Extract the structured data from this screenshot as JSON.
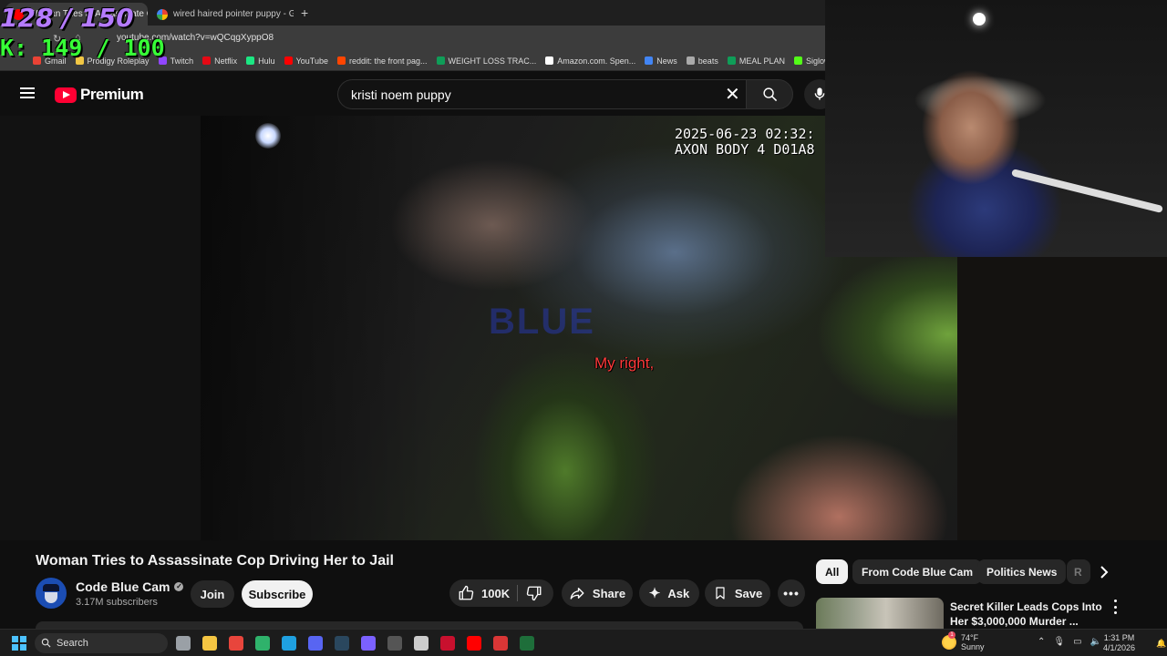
{
  "browser": {
    "tabs": [
      {
        "title": "Woman Tries to Assassinate Cop...",
        "active": true
      },
      {
        "title": "wired haired pointer puppy - G",
        "active": false
      }
    ],
    "new_tab_label": "+",
    "url": "youtube.com/watch?v=wQCqgXyppO8",
    "bookmarks": [
      {
        "label": "Gmail",
        "color": "#ea4335"
      },
      {
        "label": "Prodigy Roleplay",
        "color": "#f2c744"
      },
      {
        "label": "Twitch",
        "color": "#9146ff"
      },
      {
        "label": "Netflix",
        "color": "#e50914"
      },
      {
        "label": "Hulu",
        "color": "#1ce783"
      },
      {
        "label": "YouTube",
        "color": "#ff0000"
      },
      {
        "label": "reddit: the front pag...",
        "color": "#ff4500"
      },
      {
        "label": "WEIGHT LOSS TRAC...",
        "color": "#0f9d58"
      },
      {
        "label": "Amazon.com. Spen...",
        "color": "#ffffff"
      },
      {
        "label": "News",
        "color": "#4285f4"
      },
      {
        "label": "beats",
        "color": "#aaaaaa"
      },
      {
        "label": "MEAL PLAN",
        "color": "#0f9d58"
      },
      {
        "label": "Siglow Stream -",
        "color": "#53fc18"
      }
    ]
  },
  "overlay": {
    "counter_top": "128 / 150",
    "counter_kills": "K: 149 / 100"
  },
  "youtube": {
    "brand": "Premium",
    "search_query": "kristi noem puppy",
    "video": {
      "timestamp": "2025-06-23 02:32:\nAXON BODY 4 D01A8",
      "subtitle": "My right,",
      "watermark": "BLUE"
    },
    "title": "Woman Tries to Assassinate Cop Driving Her to Jail",
    "channel": {
      "name": "Code Blue Cam",
      "subscribers": "3.17M subscribers",
      "verified_mark": "✓"
    },
    "actions": {
      "join": "Join",
      "subscribe": "Subscribe",
      "likes": "100K",
      "share": "Share",
      "ask": "Ask",
      "save": "Save"
    },
    "chips": [
      "All",
      "From Code Blue Cam",
      "Politics News",
      "R"
    ],
    "recommended": {
      "title": "Secret Killer Leads Cops Into Her $3,000,000 Murder ..."
    }
  },
  "taskbar": {
    "search_label": "Search",
    "weather_temp": "74°F",
    "weather_cond": "Sunny",
    "notification_count": "1",
    "time": "1:31 PM",
    "date": "4/1/2026",
    "apps": [
      {
        "name": "task-view",
        "color": "#9aa0a6"
      },
      {
        "name": "file-explorer",
        "color": "#f4c542"
      },
      {
        "name": "chrome",
        "color": "#e8453c"
      },
      {
        "name": "app-green",
        "color": "#2fb26b"
      },
      {
        "name": "edge",
        "color": "#1fa0e0"
      },
      {
        "name": "discord",
        "color": "#5865f2"
      },
      {
        "name": "steam",
        "color": "#2a475e"
      },
      {
        "name": "app-multicolor",
        "color": "#7b61ff"
      },
      {
        "name": "obs",
        "color": "#555555"
      },
      {
        "name": "store",
        "color": "#cccccc"
      },
      {
        "name": "app-red",
        "color": "#c8102e"
      },
      {
        "name": "youtube-music",
        "color": "#ff0000"
      },
      {
        "name": "app-cc",
        "color": "#d93636"
      },
      {
        "name": "app-dark-green",
        "color": "#1e6e3a"
      }
    ]
  }
}
